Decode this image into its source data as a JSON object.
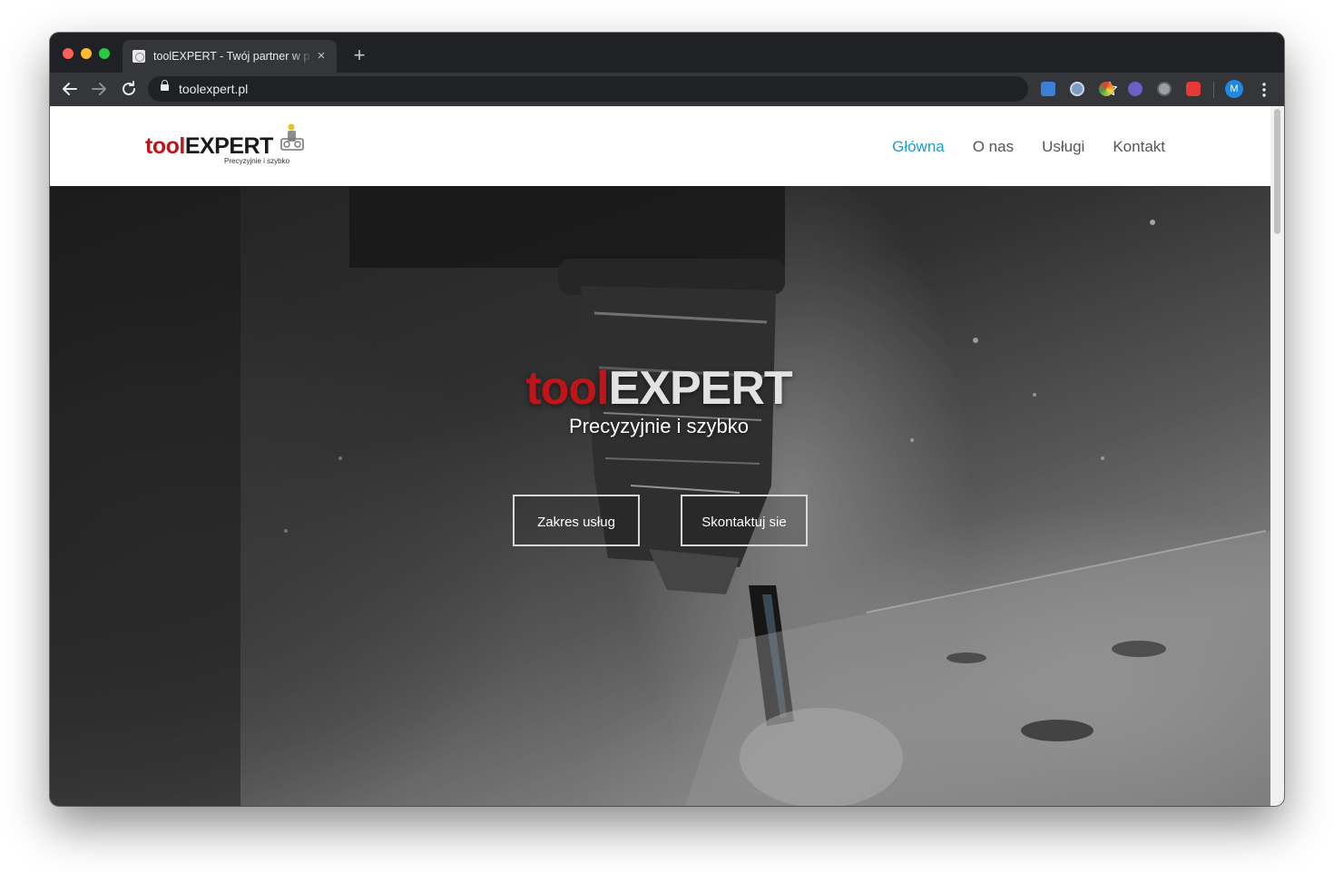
{
  "browser": {
    "tab_title": "toolEXPERT - Twój partner w p",
    "tab_close": "×",
    "new_tab": "+",
    "url": "toolexpert.pl",
    "profile_initial": "M"
  },
  "site": {
    "logo": {
      "part1": "tool",
      "part2": "EXPERT",
      "tagline": "Precyzyjnie i szybko"
    },
    "nav": [
      {
        "label": "Główna",
        "active": true
      },
      {
        "label": "O nas",
        "active": false
      },
      {
        "label": "Usługi",
        "active": false
      },
      {
        "label": "Kontakt",
        "active": false
      }
    ]
  },
  "hero": {
    "title_part1": "tool",
    "title_part2": "EXPERT",
    "subtitle": "Precyzyjnie i szybko",
    "buttons": [
      {
        "label": "Zakres usług"
      },
      {
        "label": "Skontaktuj sie"
      }
    ]
  },
  "colors": {
    "accent_red": "#c0141b",
    "nav_active": "#1a9fd1"
  }
}
